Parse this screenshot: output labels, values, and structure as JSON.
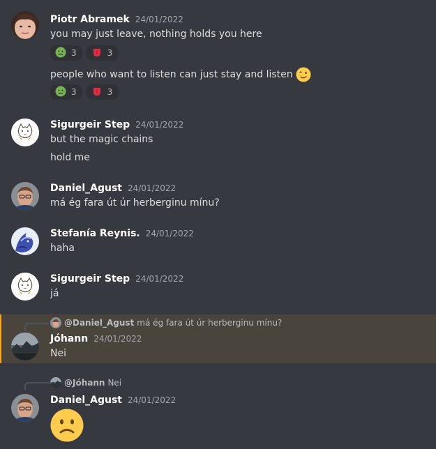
{
  "messages": [
    {
      "author": "Piotr Abramek",
      "timestamp": "24/01/2022",
      "lines": [
        "you may just leave, nothing holds you here",
        "people who want to listen can just stay and listen"
      ],
      "reactions": [
        {
          "emoji": "nauseated-face-icon",
          "count": "3"
        },
        {
          "emoji": "tongue-icon",
          "count": "3"
        }
      ],
      "inline_emoji": "winking-face-icon"
    },
    {
      "author": "Sigurgeir Step",
      "timestamp": "24/01/2022",
      "lines": [
        "but the magic chains",
        "hold me"
      ]
    },
    {
      "author": "Daniel_Agust",
      "timestamp": "24/01/2022",
      "lines": [
        "má ég fara út úr herberginu mínu?"
      ]
    },
    {
      "author": "Stefanía Reynis.",
      "timestamp": "24/01/2022",
      "lines": [
        "haha"
      ]
    },
    {
      "author": "Sigurgeir Step",
      "timestamp": "24/01/2022",
      "lines": [
        "já"
      ]
    },
    {
      "author": "Jóhann",
      "timestamp": "24/01/2022",
      "lines": [
        "Nei"
      ],
      "reply": {
        "mention": "@Daniel_Agust",
        "text": "má ég fara út úr herberginu mínu?"
      },
      "highlight_color": "#faa61a"
    },
    {
      "author": "Daniel_Agust",
      "timestamp": "24/01/2022",
      "lines": [],
      "reply": {
        "mention": "@Jóhann",
        "text": "Nei"
      },
      "big_emoji": "frowning-face-icon"
    }
  ]
}
